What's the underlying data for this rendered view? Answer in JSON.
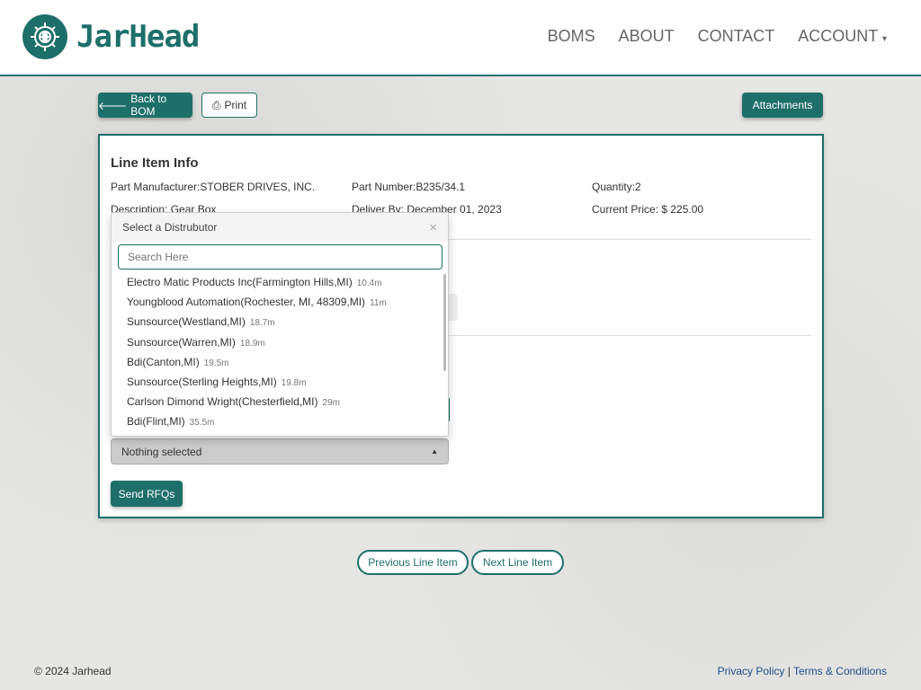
{
  "brand": {
    "name": "JarHead"
  },
  "nav": {
    "items": [
      "BOMS",
      "ABOUT",
      "CONTACT",
      "ACCOUNT"
    ]
  },
  "toolbar": {
    "back": "Back to BOM",
    "print": "Print",
    "attachments": "Attachments"
  },
  "line_item": {
    "title": "Line Item Info",
    "manufacturer": "Part Manufacturer:STOBER DRIVES, INC.",
    "part_number": "Part Number:B235/34.1",
    "quantity": "Quantity:2",
    "description": "Description: Gear Box",
    "deliver_by": "Deliver By: December 01, 2023",
    "current_price": "Current Price: $ 225.00"
  },
  "distributor_dropdown": {
    "title": "Select a Distrubutor",
    "search_placeholder": "Search Here",
    "items": [
      {
        "name": "Electro Matic Products Inc(Farmington Hills,MI)",
        "distance": "10.4m"
      },
      {
        "name": "Youngblood Automation(Rochester, MI, 48309,MI)",
        "distance": "11m"
      },
      {
        "name": "Sunsource(Westland,MI)",
        "distance": "18.7m"
      },
      {
        "name": "Sunsource(Warren,MI)",
        "distance": "18.9m"
      },
      {
        "name": "Bdi(Canton,MI)",
        "distance": "19.5m"
      },
      {
        "name": "Sunsource(Sterling Heights,MI)",
        "distance": "19.8m"
      },
      {
        "name": "Carlson Dimond Wright(Chesterfield,MI)",
        "distance": "29m"
      },
      {
        "name": "Bdi(Flint,MI)",
        "distance": "35.5m"
      }
    ],
    "selected": "Nothing selected"
  },
  "actions": {
    "send_rfqs": "Send RFQs",
    "previous": "Previous Line Item",
    "next": "Next Line Item"
  },
  "footer": {
    "copyright": "© 2024 Jarhead",
    "privacy": "Privacy Policy",
    "separator": "|",
    "terms": "Terms & Conditions"
  },
  "colors": {
    "accent": "#1e6f6a"
  }
}
